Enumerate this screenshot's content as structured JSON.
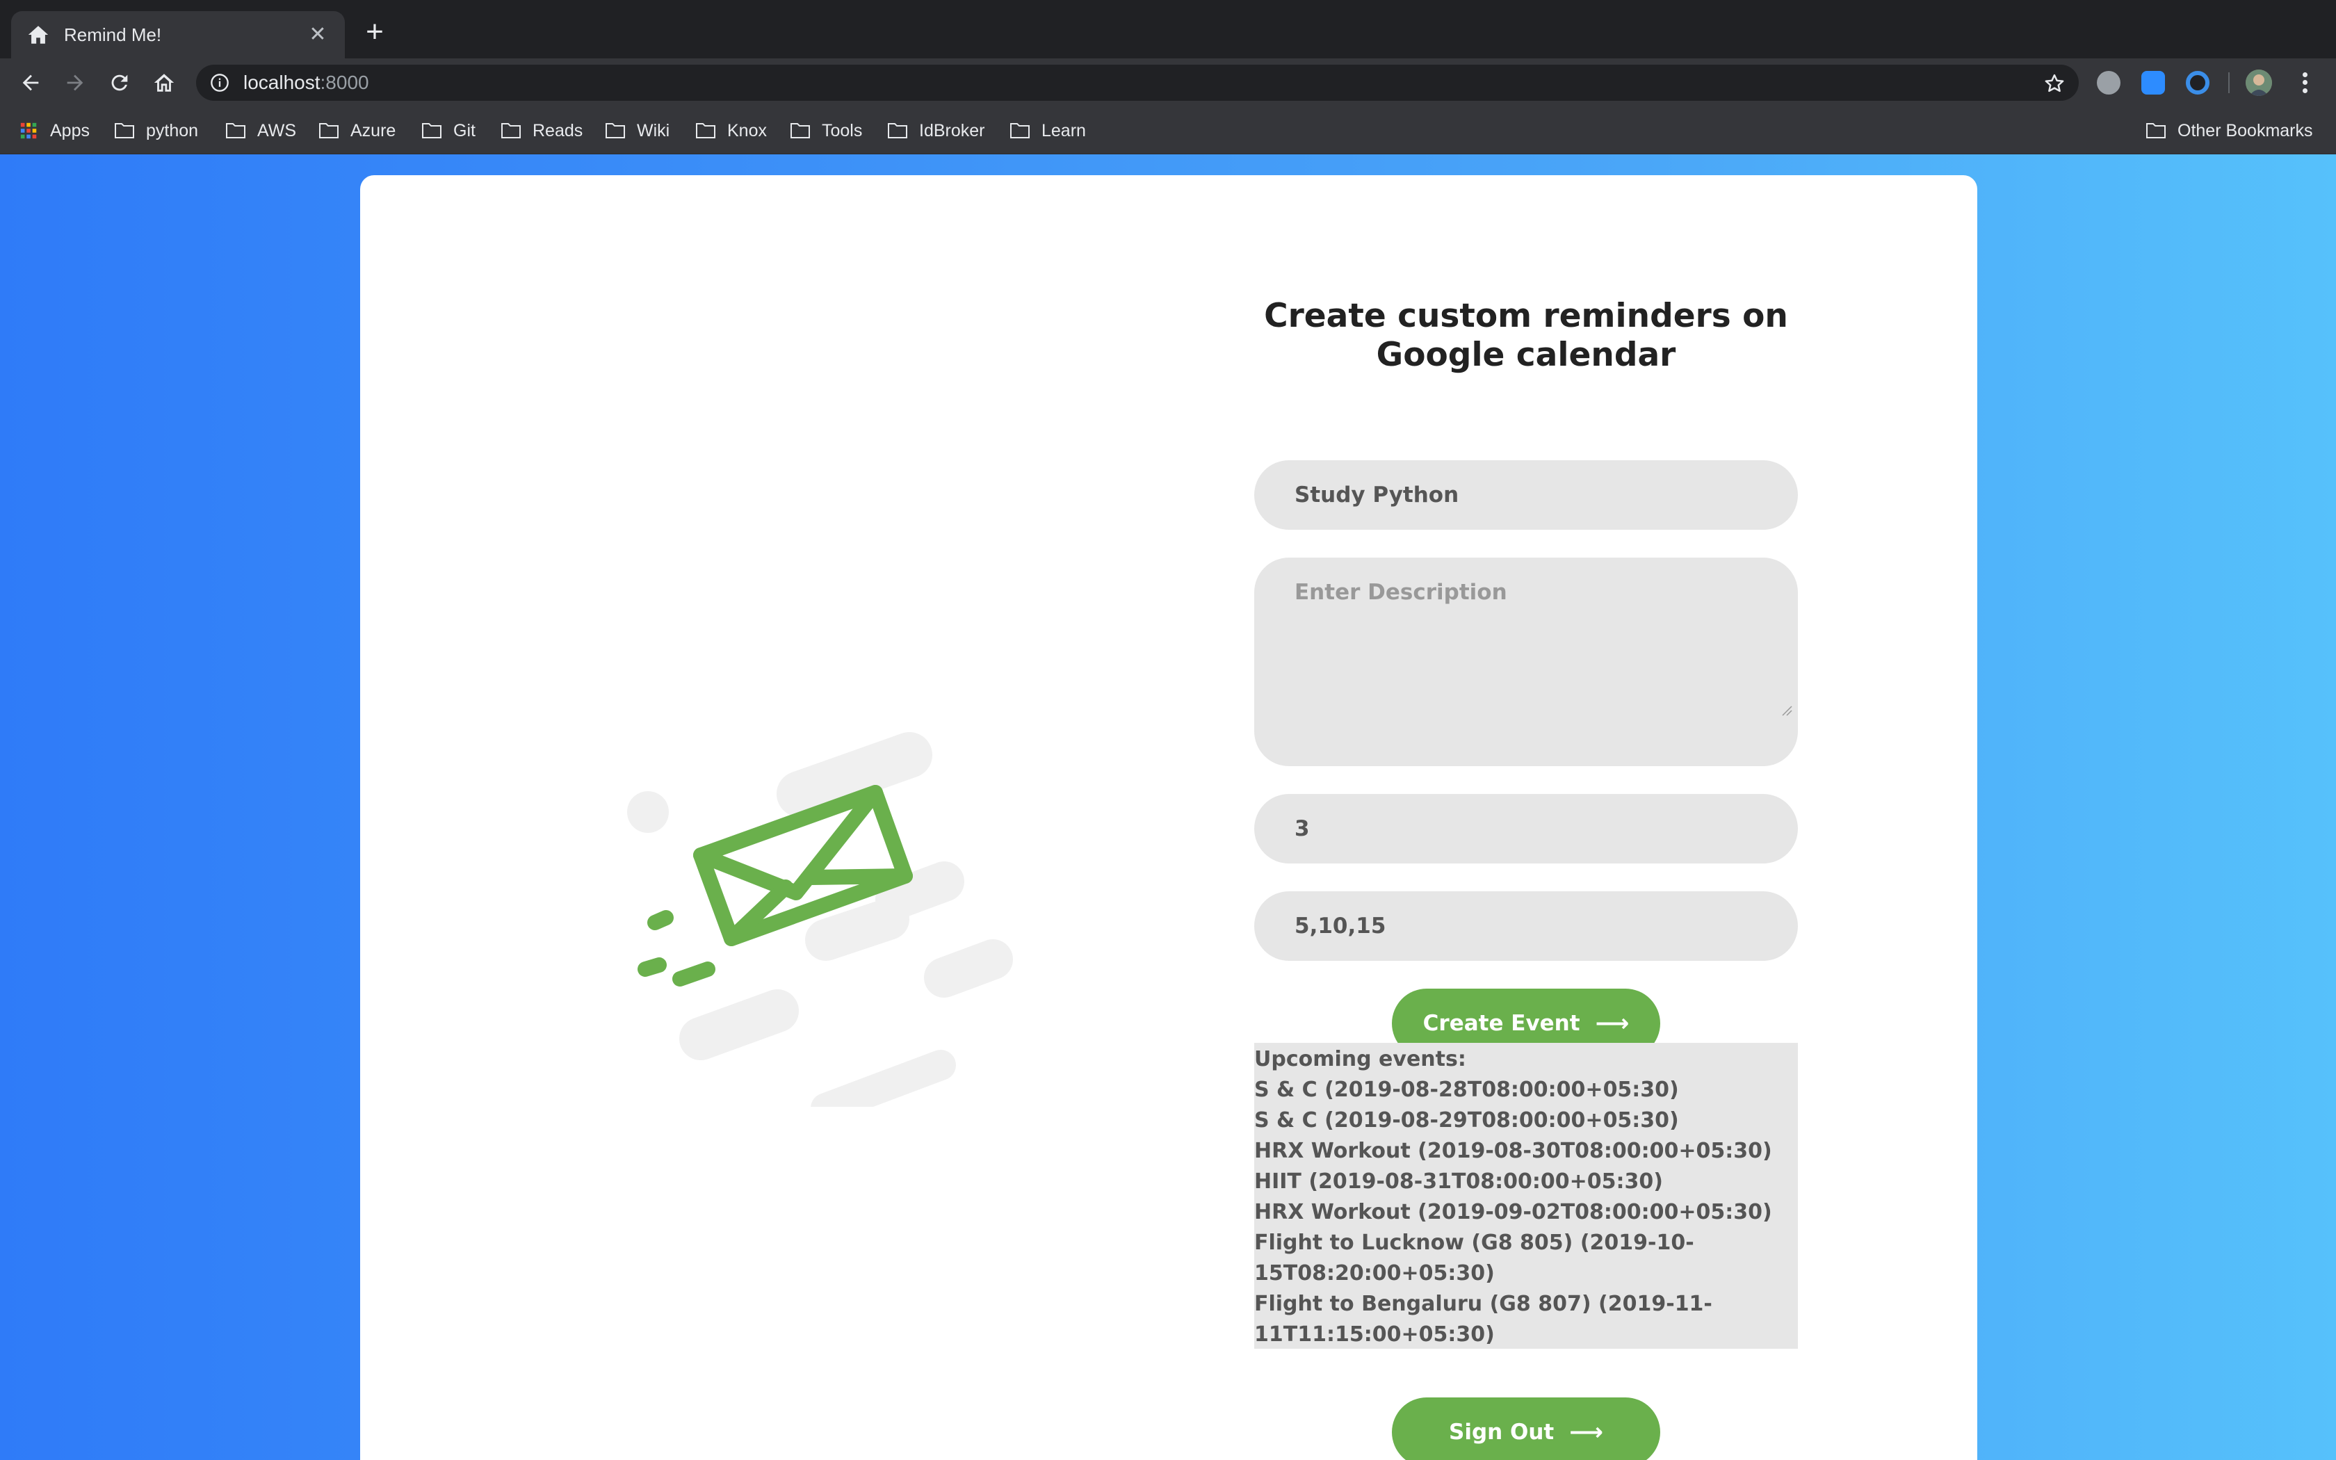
{
  "browser": {
    "tab_title": "Remind Me!",
    "url_host": "localhost",
    "url_port": ":8000",
    "bookmarks": [
      "Apps",
      "python",
      "AWS",
      "Azure",
      "Git",
      "Reads",
      "Wiki",
      "Knox",
      "Tools",
      "IdBroker",
      "Learn"
    ],
    "other_bookmarks": "Other Bookmarks"
  },
  "form": {
    "title_line1": "Create custom reminders on",
    "title_line2": "Google calendar",
    "summary_value": "Study Python",
    "description_placeholder": "Enter Description",
    "description_value": "",
    "days_value": "3",
    "minutes_value": "5,10,15",
    "create_label": "Create Event",
    "signout_label": "Sign Out"
  },
  "events": {
    "heading": "Upcoming events:",
    "lines": [
      "S & C (2019-08-28T08:00:00+05:30)",
      "S & C (2019-08-29T08:00:00+05:30)",
      "HRX Workout (2019-08-30T08:00:00+05:30)",
      "HIIT (2019-08-31T08:00:00+05:30)",
      "HRX Workout (2019-09-02T08:00:00+05:30)",
      "Flight to Lucknow (G8 805) (2019-10-",
      "15T08:20:00+05:30)",
      "Flight to Bengaluru (G8 807) (2019-11-",
      "11T11:15:00+05:30)"
    ]
  },
  "colors": {
    "accent_green": "#6ab04c",
    "field_bg": "#e6e6e6",
    "gradient_start": "#2f7bf8",
    "gradient_end": "#56c1fb"
  }
}
